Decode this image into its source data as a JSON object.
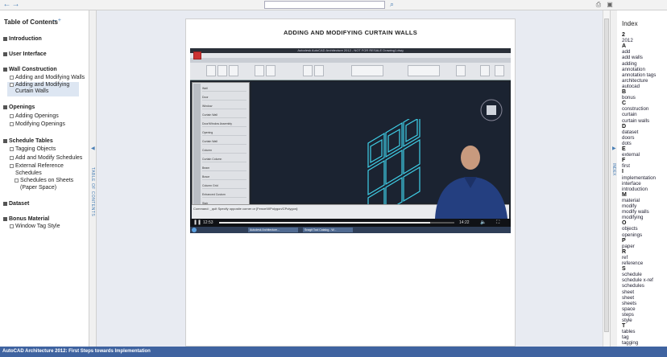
{
  "toolbar": {
    "back_icon": "←",
    "forward_icon": "→",
    "search_placeholder": "",
    "search_icon": "⌕",
    "print_icon": "⎙",
    "window_icon": "▣"
  },
  "toc": {
    "title": "Table of Contents",
    "title_controls": "–  +",
    "items": [
      {
        "label": "Introduction",
        "level": 0
      },
      {
        "label": "User Interface",
        "level": 0
      },
      {
        "label": "Wall Construction",
        "level": 0
      },
      {
        "label": "Adding and Modifying Walls",
        "level": 1
      },
      {
        "label": "Adding and Modifying",
        "level": 1
      },
      {
        "label": "Curtain Walls",
        "level": 1
      },
      {
        "label": "Openings",
        "level": 0
      },
      {
        "label": "Adding Openings",
        "level": 1
      },
      {
        "label": "Modifying Openings",
        "level": 1
      },
      {
        "label": "Schedule Tables",
        "level": 0
      },
      {
        "label": "Tagging Objects",
        "level": 1
      },
      {
        "label": "Add and Modify Schedules",
        "level": 1
      },
      {
        "label": "External Reference",
        "level": 1
      },
      {
        "label": "Schedules",
        "level": 1
      },
      {
        "label": "Schedules on Sheets",
        "level": 2
      },
      {
        "label": "(Paper Space)",
        "level": 2
      },
      {
        "label": "Dataset",
        "level": 0
      },
      {
        "label": "Bonus Material",
        "level": 0
      },
      {
        "label": "Window Tag Style",
        "level": 1
      }
    ]
  },
  "left_tab_label": "TABLE OF CONTENTS",
  "right_tab_label": "INDEX",
  "page": {
    "title": "ADDING AND MODIFYING CURTAIN WALLS"
  },
  "video": {
    "app_title": "Autodesk AutoCAD Architecture 2012  -  NOT FOR RESALE   Drawing1.dwg",
    "current_time": "12:53",
    "total_time": "14:22",
    "progress": 0.897,
    "command_text": "Command:  _quit   Specify opposite corner or [Fence/WPolygon/CPolygon]:",
    "palette_items": [
      "Wall",
      "Door",
      "Window",
      "Curtain Wall",
      "Door/Window Assembly",
      "Opening",
      "Curtain Wall",
      "Column",
      "Curtain Column",
      "Beam",
      "Brace",
      "Column Grid",
      "Enhanced Custom",
      "Stair",
      "Roof Slab"
    ],
    "taskbar_items": [
      "Autodesk Architecture...",
      "Snagit Tool Catalog - W..."
    ]
  },
  "index": {
    "title": "Index",
    "entries": [
      {
        "t": "2",
        "letter": true
      },
      {
        "t": "2012"
      },
      {
        "t": "A",
        "letter": true
      },
      {
        "t": "add"
      },
      {
        "t": "add walls"
      },
      {
        "t": "adding"
      },
      {
        "t": "annotation"
      },
      {
        "t": "annotation tags"
      },
      {
        "t": "architecture"
      },
      {
        "t": "autocad"
      },
      {
        "t": "B",
        "letter": true
      },
      {
        "t": "bonus"
      },
      {
        "t": "C",
        "letter": true
      },
      {
        "t": "construction"
      },
      {
        "t": "curtain"
      },
      {
        "t": "curtain walls"
      },
      {
        "t": "D",
        "letter": true
      },
      {
        "t": "dataset"
      },
      {
        "t": "doors"
      },
      {
        "t": "dots"
      },
      {
        "t": "E",
        "letter": true
      },
      {
        "t": "external"
      },
      {
        "t": "F",
        "letter": true
      },
      {
        "t": "first"
      },
      {
        "t": "I",
        "letter": true
      },
      {
        "t": "implementation"
      },
      {
        "t": "interface"
      },
      {
        "t": "introduction"
      },
      {
        "t": "M",
        "letter": true
      },
      {
        "t": "material"
      },
      {
        "t": "modify"
      },
      {
        "t": "modify walls"
      },
      {
        "t": "modifying"
      },
      {
        "t": "O",
        "letter": true
      },
      {
        "t": "objects"
      },
      {
        "t": "openings"
      },
      {
        "t": "P",
        "letter": true
      },
      {
        "t": "paper"
      },
      {
        "t": "R",
        "letter": true
      },
      {
        "t": "ref"
      },
      {
        "t": "reference"
      },
      {
        "t": "S",
        "letter": true
      },
      {
        "t": "schedule"
      },
      {
        "t": "schedule x-ref"
      },
      {
        "t": "schedules"
      },
      {
        "t": "sheet"
      },
      {
        "t": "sheet"
      },
      {
        "t": "sheets"
      },
      {
        "t": "space"
      },
      {
        "t": "steps"
      },
      {
        "t": "style"
      },
      {
        "t": "T",
        "letter": true
      },
      {
        "t": "tables"
      },
      {
        "t": "tag"
      },
      {
        "t": "tagging"
      }
    ]
  },
  "status": {
    "text": "AutoCAD Architecture 2012: First Steps towards Implementation"
  },
  "colors": {
    "accent": "#4a7fb5",
    "status_bar": "#3f63a0",
    "wall_cyan": "#3fd0e8"
  }
}
